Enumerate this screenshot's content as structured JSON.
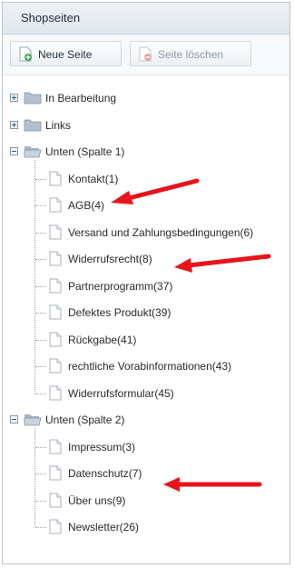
{
  "panel": {
    "title": "Shopseiten",
    "new_button": "Neue Seite",
    "delete_button": "Seite löschen"
  },
  "tree": {
    "folders": [
      {
        "label": "In Bearbeitung",
        "expanded": false,
        "children": []
      },
      {
        "label": "Links",
        "expanded": false,
        "children": []
      },
      {
        "label": "Unten (Spalte 1)",
        "expanded": true,
        "children": [
          "Kontakt(1)",
          "AGB(4)",
          "Versand und Zahlungsbedingungen(6)",
          "Widerrufsrecht(8)",
          "Partnerprogramm(37)",
          "Defektes Produkt(39)",
          "Rückgabe(41)",
          "rechtliche Vorabinformationen(43)",
          "Widerrufsformular(45)"
        ]
      },
      {
        "label": "Unten (Spalte 2)",
        "expanded": true,
        "children": [
          "Impressum(3)",
          "Datenschutz(7)",
          "Über uns(9)",
          "Newsletter(26)"
        ]
      }
    ]
  },
  "annotations": {
    "arrow_color": "#e8141b",
    "highlighted_items": [
      "AGB(4)",
      "Widerrufsrecht(8)",
      "Datenschutz(7)"
    ]
  }
}
